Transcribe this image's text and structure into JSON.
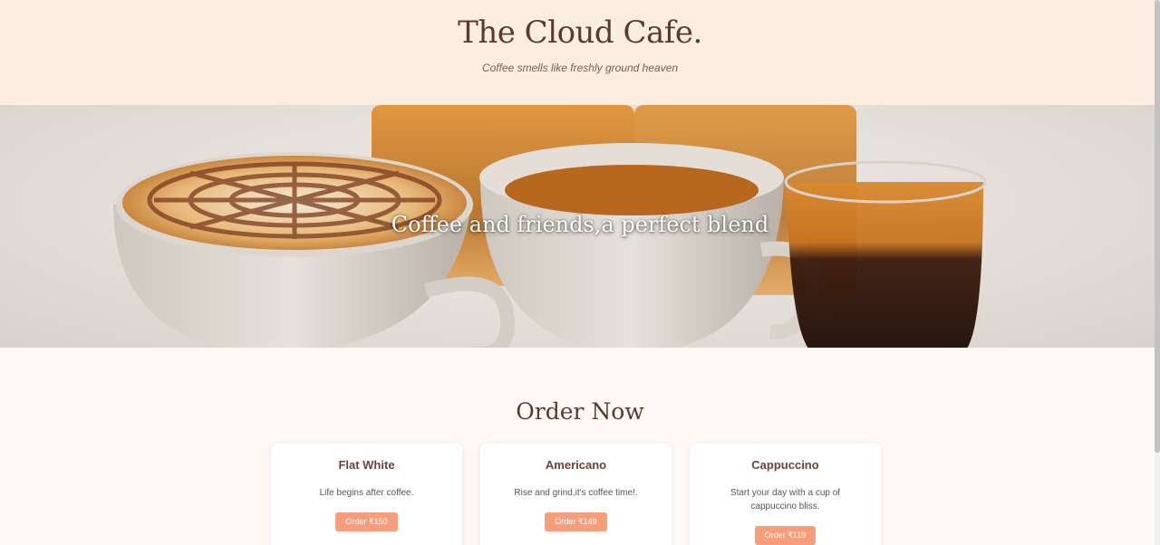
{
  "header": {
    "title": "The Cloud Cafe.",
    "tagline": "Coffee smells like freshly ground heaven"
  },
  "hero": {
    "text": "Coffee and friends,a perfect blend",
    "image": "coffee-cups-photo"
  },
  "order": {
    "title": "Order Now",
    "items": [
      {
        "name": "Flat White",
        "description": "Life begins after coffee.",
        "button": "Order ₹150"
      },
      {
        "name": "Americano",
        "description": "Rise and grind,it's coffee time!.",
        "button": "Order ₹149"
      },
      {
        "name": "Cappuccino",
        "description": "Start your day with a cup of cappuccino bliss.",
        "button": "Order ₹119"
      }
    ]
  },
  "colors": {
    "header_bg": "#fcede3",
    "accent": "#f79d7b",
    "title_text": "#5a3a2e"
  }
}
